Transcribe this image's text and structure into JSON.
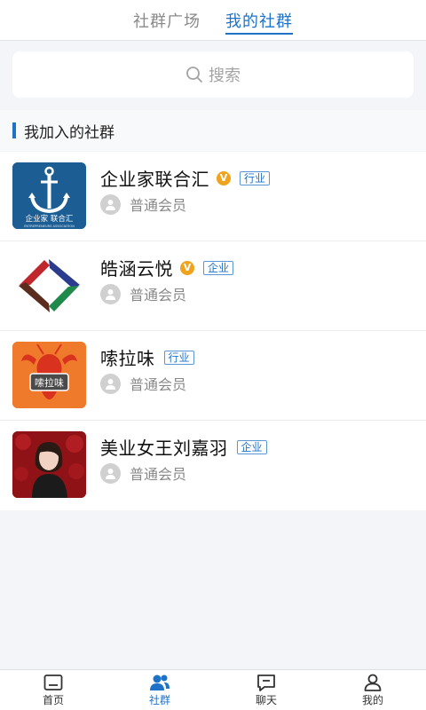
{
  "top_tabs": {
    "square": "社群广场",
    "mine": "我的社群"
  },
  "search": {
    "placeholder": "搜索",
    "icon": "search-icon"
  },
  "section": {
    "title": "我加入的社群"
  },
  "groups": [
    {
      "name": "企业家联合汇",
      "verified": true,
      "tag": "行业",
      "member_level": "普通会员",
      "logo_text": "企业家 联合汇",
      "logo_subtext": "ENTREPRENEURS ASSOCIATION"
    },
    {
      "name": "皓涵云悦",
      "verified": true,
      "tag": "企业",
      "member_level": "普通会员"
    },
    {
      "name": "嗦拉味",
      "verified": false,
      "tag": "行业",
      "member_level": "普通会员",
      "logo_text": "嗦拉味"
    },
    {
      "name": "美业女王刘嘉羽",
      "verified": false,
      "tag": "企业",
      "member_level": "普通会员"
    }
  ],
  "verified_label": "V",
  "bottom_nav": {
    "home": "首页",
    "community": "社群",
    "chat": "聊天",
    "mine": "我的"
  },
  "colors": {
    "accent": "#1e72c8",
    "badge": "#f0a31c",
    "background": "#f3f5f8"
  }
}
